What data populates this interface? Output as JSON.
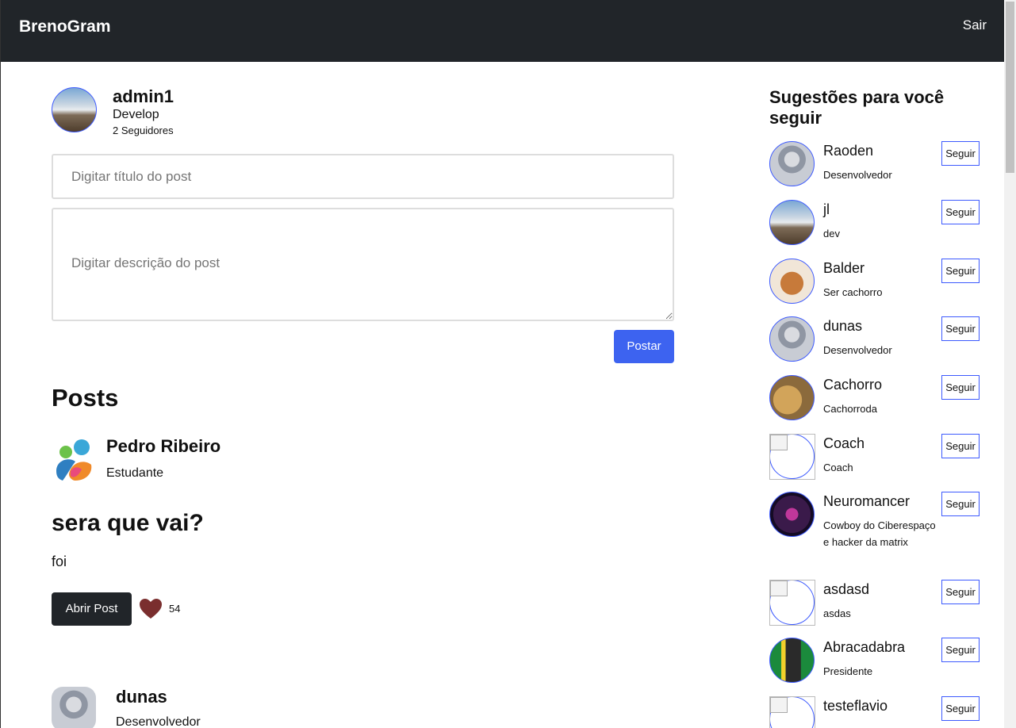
{
  "navbar": {
    "brand": "BrenoGram",
    "logout_label": "Sair"
  },
  "profile": {
    "name": "admin1",
    "role": "Develop",
    "followers": "2 Seguidores"
  },
  "composer": {
    "title_placeholder": "Digitar título do post",
    "description_placeholder": "Digitar descrição do post",
    "submit_label": "Postar"
  },
  "posts_heading": "Posts",
  "posts": [
    {
      "author": "Pedro Ribeiro",
      "author_role": "Estudante",
      "title": "sera que vai?",
      "body": "foi",
      "open_label": "Abrir Post",
      "likes": "54"
    },
    {
      "author": "dunas",
      "author_role": "Desenvolvedor"
    }
  ],
  "suggestions": {
    "title": "Sugestões para você seguir",
    "follow_label": "Seguir",
    "items": [
      {
        "name": "Raoden",
        "role": "Desenvolvedor"
      },
      {
        "name": "jl",
        "role": "dev"
      },
      {
        "name": "Balder",
        "role": "Ser cachorro"
      },
      {
        "name": "dunas",
        "role": "Desenvolvedor"
      },
      {
        "name": "Cachorro",
        "role": "Cachorroda"
      },
      {
        "name": "Coach",
        "role": "Coach"
      },
      {
        "name": "Neuromancer",
        "role": "Cowboy do Ciberespaço e hacker da matrix"
      },
      {
        "name": "asdasd",
        "role": "asdas"
      },
      {
        "name": "Abracadabra",
        "role": "Presidente"
      },
      {
        "name": "testeflavio",
        "role": ""
      }
    ]
  },
  "colors": {
    "navbar": "#212529",
    "primary": "#3d63f0",
    "heart": "#7a2e2e"
  }
}
